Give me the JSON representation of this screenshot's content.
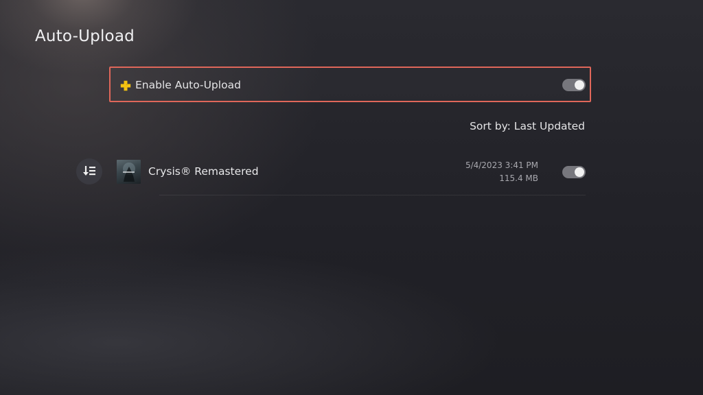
{
  "page": {
    "title": "Auto-Upload"
  },
  "enable_auto_upload": {
    "label": "Enable Auto-Upload",
    "icon": "ps-plus-icon",
    "enabled": true
  },
  "sort": {
    "label": "Sort by: Last Updated"
  },
  "games": [
    {
      "name": "Crysis® Remastered",
      "date": "5/4/2023  3:41 PM",
      "size": "115.4 MB",
      "enabled": true
    }
  ],
  "colors": {
    "focus_border": "#e0675a",
    "ps_plus_gold": "#f4c312",
    "toggle_track": "#77777d",
    "toggle_knob": "#f1f1f1"
  }
}
